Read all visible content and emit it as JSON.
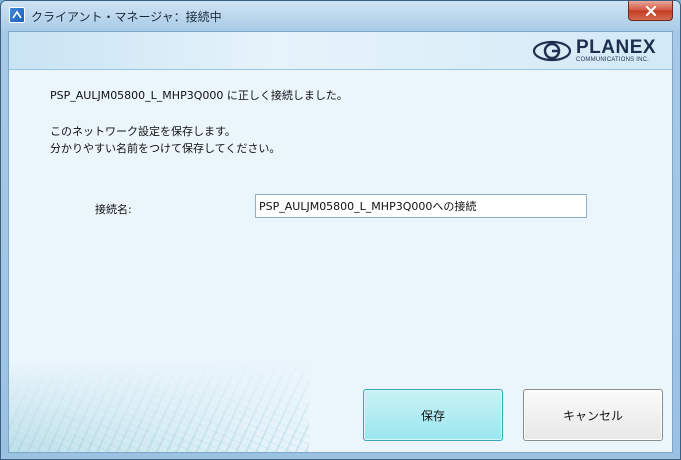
{
  "window": {
    "title": "クライアント・マネージャ：接続中"
  },
  "brand": {
    "name": "PLANEX",
    "tagline": "COMMUNICATIONS INC."
  },
  "messages": {
    "connected": "PSP_AULJM05800_L_MHP3Q000 に正しく接続しました。",
    "save_notice": "このネットワーク設定を保存します。",
    "name_hint": "分かりやすい名前をつけて保存してください。"
  },
  "form": {
    "connection_name_label": "接続名:",
    "connection_name_value": "PSP_AULJM05800_L_MHP3Q000への接続"
  },
  "buttons": {
    "save": "保存",
    "cancel": "キャンセル"
  },
  "icons": {
    "app": "app-icon",
    "close": "close-icon",
    "logo": "planex-logo-icon"
  }
}
